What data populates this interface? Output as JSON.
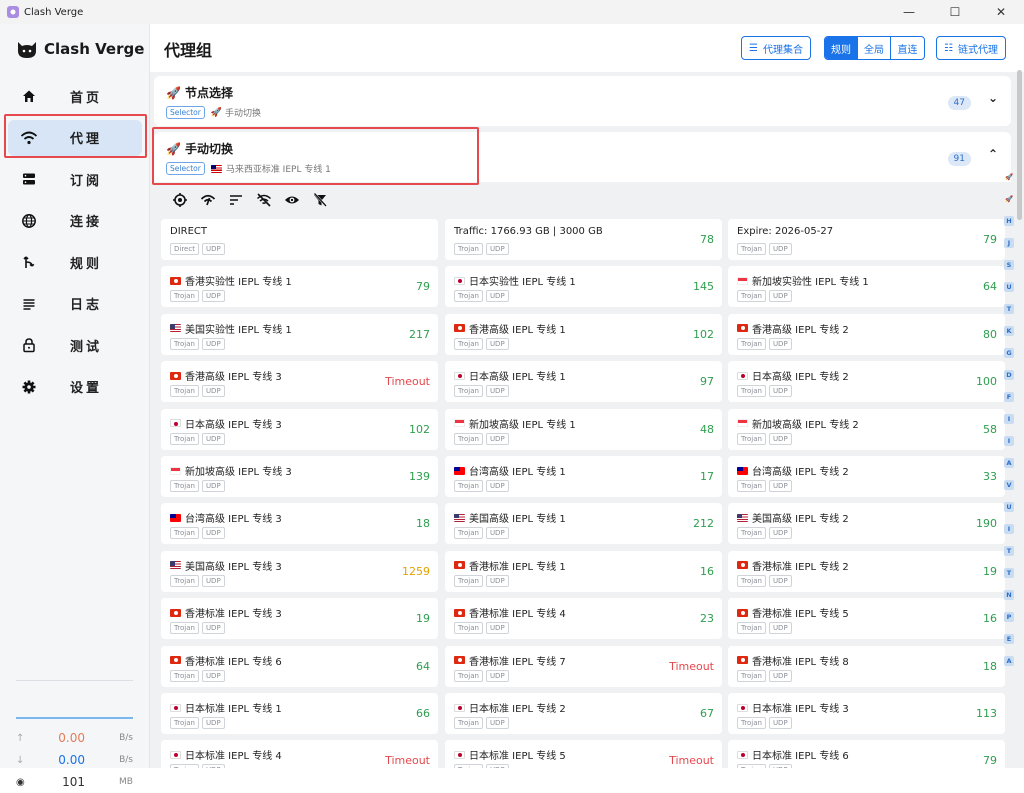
{
  "window": {
    "title": "Clash Verge"
  },
  "sidebar": {
    "app_name": "Clash Verge",
    "items": [
      {
        "label": "首页",
        "icon": "home-icon"
      },
      {
        "label": "代理",
        "icon": "wifi-icon",
        "active": true
      },
      {
        "label": "订阅",
        "icon": "storage-icon"
      },
      {
        "label": "连接",
        "icon": "globe-icon"
      },
      {
        "label": "规则",
        "icon": "fork-icon"
      },
      {
        "label": "日志",
        "icon": "list-icon"
      },
      {
        "label": "测试",
        "icon": "lock-icon"
      },
      {
        "label": "设置",
        "icon": "gear-icon"
      }
    ],
    "traffic": {
      "up": {
        "value": "0.00",
        "unit": "B/s",
        "color": "#e57c5a"
      },
      "down": {
        "value": "0.00",
        "unit": "B/s",
        "color": "#1a73e8"
      },
      "mem": {
        "value": "101",
        "unit": "MB"
      }
    }
  },
  "header": {
    "title": "代理组",
    "collection_btn": "代理集合",
    "modes": [
      "规则",
      "全局",
      "直连"
    ],
    "active_mode": "规则",
    "chain_btn": "链式代理"
  },
  "groups": [
    {
      "name": "节点选择",
      "type": "Selector",
      "current": "手动切换",
      "current_icon": "rocket",
      "count": "47",
      "expanded": false
    },
    {
      "name": "手动切换",
      "type": "Selector",
      "current": "马来西亚标准 IEPL 专线 1",
      "current_icon": "my",
      "count": "91",
      "expanded": true
    }
  ],
  "proxies": [
    {
      "name": "DIRECT",
      "flag": "",
      "tags": [
        "Direct",
        "UDP"
      ],
      "delay": "",
      "status": ""
    },
    {
      "name": "Traffic: 1766.93 GB | 3000 GB",
      "flag": "",
      "tags": [
        "Trojan",
        "UDP"
      ],
      "delay": "78",
      "status": "g"
    },
    {
      "name": "Expire: 2026-05-27",
      "flag": "",
      "tags": [
        "Trojan",
        "UDP"
      ],
      "delay": "79",
      "status": "g"
    },
    {
      "name": "香港实验性 IEPL 专线 1",
      "flag": "hk",
      "tags": [
        "Trojan",
        "UDP"
      ],
      "delay": "79",
      "status": "g"
    },
    {
      "name": "日本实验性 IEPL 专线 1",
      "flag": "jp",
      "tags": [
        "Trojan",
        "UDP"
      ],
      "delay": "145",
      "status": "g"
    },
    {
      "name": "新加坡实验性 IEPL 专线 1",
      "flag": "sg",
      "tags": [
        "Trojan",
        "UDP"
      ],
      "delay": "64",
      "status": "g"
    },
    {
      "name": "美国实验性 IEPL 专线 1",
      "flag": "us",
      "tags": [
        "Trojan",
        "UDP"
      ],
      "delay": "217",
      "status": "g"
    },
    {
      "name": "香港高级 IEPL 专线 1",
      "flag": "hk",
      "tags": [
        "Trojan",
        "UDP"
      ],
      "delay": "102",
      "status": "g"
    },
    {
      "name": "香港高级 IEPL 专线 2",
      "flag": "hk",
      "tags": [
        "Trojan",
        "UDP"
      ],
      "delay": "80",
      "status": "g"
    },
    {
      "name": "香港高级 IEPL 专线 3",
      "flag": "hk",
      "tags": [
        "Trojan",
        "UDP"
      ],
      "delay": "Timeout",
      "status": "r"
    },
    {
      "name": "日本高级 IEPL 专线 1",
      "flag": "jp",
      "tags": [
        "Trojan",
        "UDP"
      ],
      "delay": "97",
      "status": "g"
    },
    {
      "name": "日本高级 IEPL 专线 2",
      "flag": "jp",
      "tags": [
        "Trojan",
        "UDP"
      ],
      "delay": "100",
      "status": "g"
    },
    {
      "name": "日本高级 IEPL 专线 3",
      "flag": "jp",
      "tags": [
        "Trojan",
        "UDP"
      ],
      "delay": "102",
      "status": "g"
    },
    {
      "name": "新加坡高级 IEPL 专线 1",
      "flag": "sg",
      "tags": [
        "Trojan",
        "UDP"
      ],
      "delay": "48",
      "status": "g"
    },
    {
      "name": "新加坡高级 IEPL 专线 2",
      "flag": "sg",
      "tags": [
        "Trojan",
        "UDP"
      ],
      "delay": "58",
      "status": "g"
    },
    {
      "name": "新加坡高级 IEPL 专线 3",
      "flag": "sg",
      "tags": [
        "Trojan",
        "UDP"
      ],
      "delay": "139",
      "status": "g"
    },
    {
      "name": "台湾高级 IEPL 专线 1",
      "flag": "tw",
      "tags": [
        "Trojan",
        "UDP"
      ],
      "delay": "17",
      "status": "g"
    },
    {
      "name": "台湾高级 IEPL 专线 2",
      "flag": "tw",
      "tags": [
        "Trojan",
        "UDP"
      ],
      "delay": "33",
      "status": "g"
    },
    {
      "name": "台湾高级 IEPL 专线 3",
      "flag": "tw",
      "tags": [
        "Trojan",
        "UDP"
      ],
      "delay": "18",
      "status": "g"
    },
    {
      "name": "美国高级 IEPL 专线 1",
      "flag": "us",
      "tags": [
        "Trojan",
        "UDP"
      ],
      "delay": "212",
      "status": "g"
    },
    {
      "name": "美国高级 IEPL 专线 2",
      "flag": "us",
      "tags": [
        "Trojan",
        "UDP"
      ],
      "delay": "190",
      "status": "g"
    },
    {
      "name": "美国高级 IEPL 专线 3",
      "flag": "us",
      "tags": [
        "Trojan",
        "UDP"
      ],
      "delay": "1259",
      "status": "o"
    },
    {
      "name": "香港标准 IEPL 专线 1",
      "flag": "hk",
      "tags": [
        "Trojan",
        "UDP"
      ],
      "delay": "16",
      "status": "g"
    },
    {
      "name": "香港标准 IEPL 专线 2",
      "flag": "hk",
      "tags": [
        "Trojan",
        "UDP"
      ],
      "delay": "19",
      "status": "g"
    },
    {
      "name": "香港标准 IEPL 专线 3",
      "flag": "hk",
      "tags": [
        "Trojan",
        "UDP"
      ],
      "delay": "19",
      "status": "g"
    },
    {
      "name": "香港标准 IEPL 专线 4",
      "flag": "hk",
      "tags": [
        "Trojan",
        "UDP"
      ],
      "delay": "23",
      "status": "g"
    },
    {
      "name": "香港标准 IEPL 专线 5",
      "flag": "hk",
      "tags": [
        "Trojan",
        "UDP"
      ],
      "delay": "16",
      "status": "g"
    },
    {
      "name": "香港标准 IEPL 专线 6",
      "flag": "hk",
      "tags": [
        "Trojan",
        "UDP"
      ],
      "delay": "64",
      "status": "g"
    },
    {
      "name": "香港标准 IEPL 专线 7",
      "flag": "hk",
      "tags": [
        "Trojan",
        "UDP"
      ],
      "delay": "Timeout",
      "status": "r"
    },
    {
      "name": "香港标准 IEPL 专线 8",
      "flag": "hk",
      "tags": [
        "Trojan",
        "UDP"
      ],
      "delay": "18",
      "status": "g"
    },
    {
      "name": "日本标准 IEPL 专线 1",
      "flag": "jp",
      "tags": [
        "Trojan",
        "UDP"
      ],
      "delay": "66",
      "status": "g"
    },
    {
      "name": "日本标准 IEPL 专线 2",
      "flag": "jp",
      "tags": [
        "Trojan",
        "UDP"
      ],
      "delay": "67",
      "status": "g"
    },
    {
      "name": "日本标准 IEPL 专线 3",
      "flag": "jp",
      "tags": [
        "Trojan",
        "UDP"
      ],
      "delay": "113",
      "status": "g"
    },
    {
      "name": "日本标准 IEPL 专线 4",
      "flag": "jp",
      "tags": [
        "Trojan",
        "UDP"
      ],
      "delay": "Timeout",
      "status": "r"
    },
    {
      "name": "日本标准 IEPL 专线 5",
      "flag": "jp",
      "tags": [
        "Trojan",
        "UDP"
      ],
      "delay": "Timeout",
      "status": "r"
    },
    {
      "name": "日本标准 IEPL 专线 6",
      "flag": "jp",
      "tags": [
        "Trojan",
        "UDP"
      ],
      "delay": "79",
      "status": "g"
    }
  ],
  "letter_index": [
    "🚀",
    "🚀",
    "H",
    "J",
    "S",
    "U",
    "T",
    "K",
    "G",
    "D",
    "F",
    "I",
    "I",
    "A",
    "V",
    "U",
    "I",
    "T",
    "T",
    "N",
    "P",
    "E",
    "A"
  ],
  "colors": {
    "accent": "#1a73e8",
    "ok": "#2e9e4f",
    "slow": "#e5a100",
    "timeout": "#e5484d",
    "highlight": "#e5484d"
  }
}
